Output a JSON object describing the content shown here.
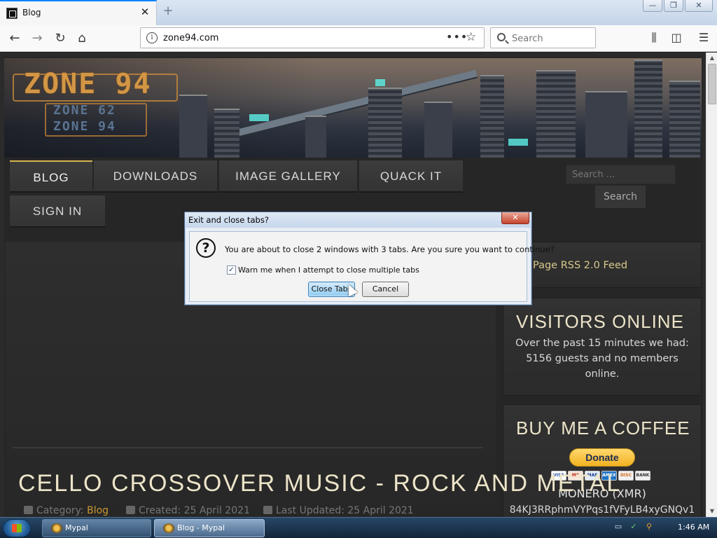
{
  "browser": {
    "tab_title": "Blog",
    "tab_close": "✕",
    "new_tab": "+",
    "url": "zone94.com",
    "url_info_glyph": "i",
    "page_actions_glyph": "•••",
    "bookmark_glyph": "☆",
    "search_placeholder": "Search",
    "icons": [
      "back-icon",
      "forward-icon",
      "reload-icon",
      "home-icon",
      "library-icon",
      "sidebar-icon",
      "menu-icon"
    ],
    "window_controls": {
      "minimize": "—",
      "restore": "❐",
      "close": "✕"
    }
  },
  "site": {
    "logo": {
      "main": "ZONE 94",
      "sub1": "ZONE 62",
      "sub2": "ZONE 94"
    },
    "nav": [
      "BLOG",
      "DOWNLOADS",
      "IMAGE GALLERY",
      "QUACK IT",
      "SIGN IN"
    ],
    "nav_active": "BLOG",
    "sidebar_search": {
      "placeholder": "Search ...",
      "button": "Search"
    },
    "rss": "Page RSS 2.0 Feed",
    "visitors": {
      "title": "VISITORS ONLINE",
      "lines": [
        "Over the past 15 minutes we had:",
        "5156 guests and no members",
        "online."
      ]
    },
    "coffee": {
      "title": "BUY ME A COFFEE",
      "donate": "Donate",
      "cards": [
        "VISA",
        "MC",
        "MAE",
        "AMEX",
        "DISC",
        "BANK"
      ],
      "currency": "MONERO (XMR)",
      "address": "84KJ3RRphmVYPqs1fVFyLB4xyGNQv1"
    },
    "article": {
      "title": "CELLO CROSSOVER MUSIC - ROCK AND METAL",
      "category_label": "Category:",
      "category": "Blog",
      "created": "Created: 25 April 2021",
      "updated": "Last Updated: 25 April 2021"
    }
  },
  "dialog": {
    "title": "Exit and close tabs?",
    "close_glyph": "✕",
    "icon_glyph": "?",
    "message": "You are about to close 2 windows with 3 tabs. Are you sure you want to continue?",
    "checkbox_checked": true,
    "checkbox_glyph": "✓",
    "checkbox_label": "Warn me when I attempt to close multiple tabs",
    "primary_button": "Close Tabs",
    "secondary_button": "Cancel"
  },
  "taskbar": {
    "items": [
      {
        "label": "Mypal",
        "active": false
      },
      {
        "label": "Blog - Mypal",
        "active": true
      }
    ],
    "clock": "1:46 AM"
  }
}
